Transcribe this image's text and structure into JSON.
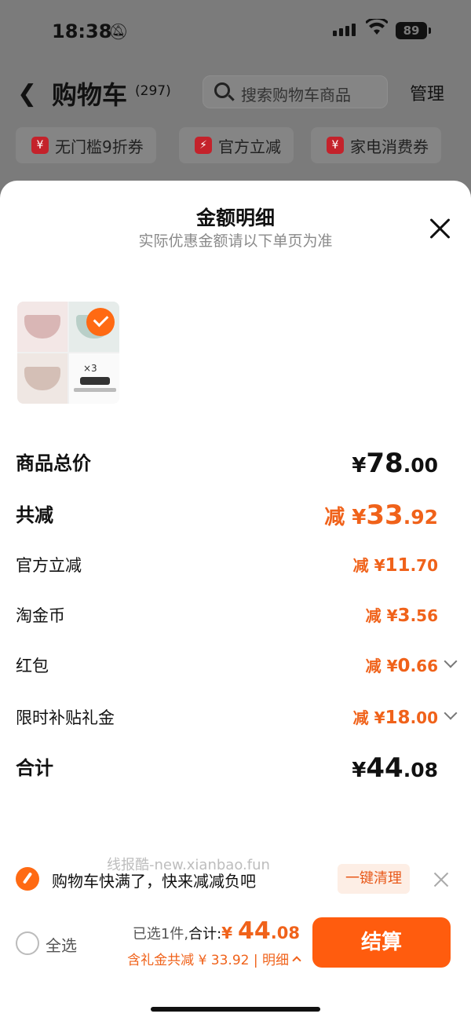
{
  "status_bar": {
    "time": "18:38",
    "battery": "89"
  },
  "header": {
    "title": "购物车",
    "count": "(297)",
    "search_placeholder": "搜索购物车商品",
    "manage_label": "管理"
  },
  "chips": [
    {
      "label": "无门槛9折券",
      "icon": "coupon-icon"
    },
    {
      "label": "官方立减",
      "icon": "lightning-icon"
    },
    {
      "label": "家电消费券",
      "icon": "coupon-icon"
    }
  ],
  "sheet": {
    "title": "金额明细",
    "subtitle": "实际优惠金额请以下单页为准",
    "product_image": {
      "caption": "×3",
      "selected": true
    },
    "rows": [
      {
        "label": "商品总价",
        "prefix": "¥",
        "int": "78",
        "dec": ".00"
      },
      {
        "label": "共减",
        "prefix": "减 ¥",
        "int": "33",
        "dec": ".92"
      },
      {
        "label": "官方立减",
        "prefix": "减 ¥",
        "int": "11",
        "dec": ".70"
      },
      {
        "label": "淘金币",
        "prefix": "减 ¥",
        "int": "3",
        "dec": ".56"
      },
      {
        "label": "红包",
        "prefix": "减 ¥",
        "int": "0",
        "dec": ".66"
      },
      {
        "label": "限时补贴礼金",
        "prefix": "减 ¥",
        "int": "18",
        "dec": ".00"
      },
      {
        "label": "合计",
        "prefix": "¥",
        "int": "44",
        "dec": ".08"
      }
    ]
  },
  "watermark": "线报酷-new.xianbao.fun",
  "notice": {
    "message": "购物车快满了，快来减减负吧",
    "button": "一键清理"
  },
  "footer": {
    "select_all": "全选",
    "selected_text": "已选1件,",
    "total_label": "合计:",
    "currency": "¥ ",
    "total_int": "44",
    "total_dec": ".08",
    "discount_text": "含礼金共减 ¥ 33.92 | 明细",
    "checkout": "结算"
  },
  "colors": {
    "accent": "#ff5c0e",
    "discount": "#f0621a"
  }
}
